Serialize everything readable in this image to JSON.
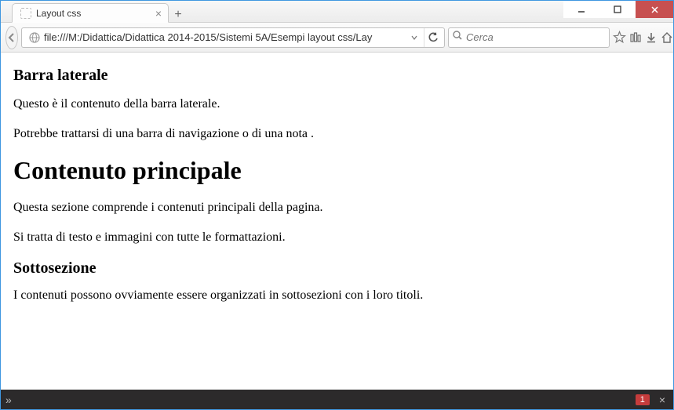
{
  "window": {
    "tab_title": "Layout css",
    "url": "file:///M:/Didattica/Didattica 2014-2015/Sistemi 5A/Esempi layout css/Lay",
    "search_placeholder": "Cerca"
  },
  "page": {
    "aside_heading": "Barra laterale",
    "aside_p1": "Questo è il contenuto della barra laterale.",
    "aside_p2": "Potrebbe trattarsi di una barra di navigazione o di una nota .",
    "main_heading": "Contenuto principale",
    "main_p1": "Questa sezione comprende i contenuti principali della pagina.",
    "main_p2": "Si tratta di testo e immagini con tutte le formattazioni.",
    "sub_heading": "Sottosezione",
    "sub_p1": "I contenuti possono ovviamente essere organizzati in sottosezioni con i loro titoli."
  },
  "bottombar": {
    "error_count": "1"
  }
}
